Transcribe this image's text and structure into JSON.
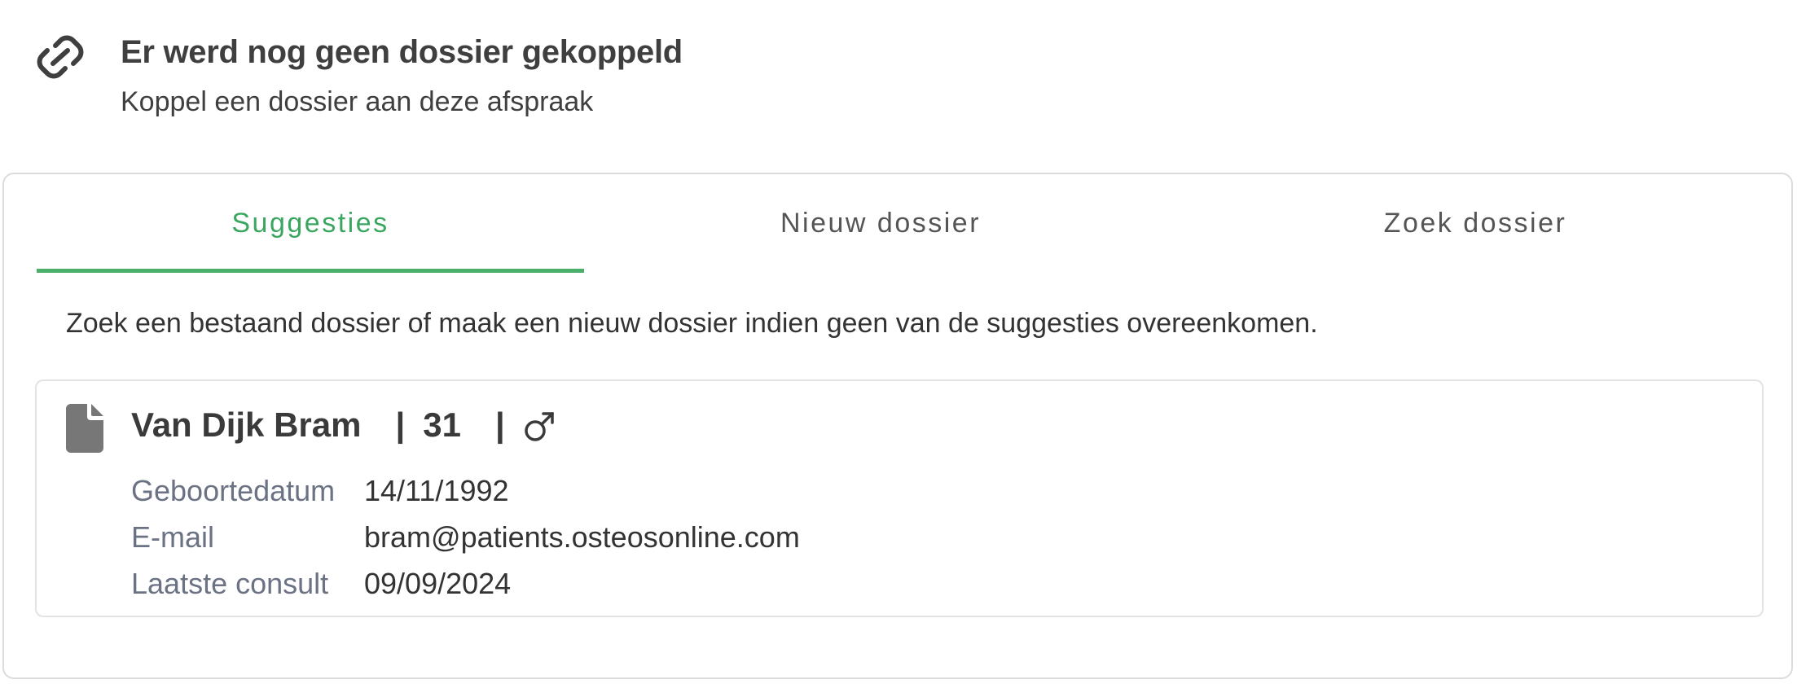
{
  "header": {
    "icon": "link-icon",
    "title": "Er werd nog geen dossier gekoppeld",
    "subtitle": "Koppel een dossier aan deze afspraak"
  },
  "tabs": [
    {
      "label": "Suggesties",
      "active": true
    },
    {
      "label": "Nieuw dossier",
      "active": false
    },
    {
      "label": "Zoek dossier",
      "active": false
    }
  ],
  "helper_text": "Zoek een bestaand dossier of maak een nieuw dossier indien geen van de suggesties overeenkomen.",
  "suggestion": {
    "icon": "file-icon",
    "name": "Van Dijk Bram",
    "separator": "|",
    "age": "31",
    "gender_icon": "male-icon",
    "details": [
      {
        "label": "Geboortedatum",
        "value": "14/11/1992"
      },
      {
        "label": "E-mail",
        "value": "bram@patients.osteosonline.com"
      },
      {
        "label": "Laatste consult",
        "value": "09/09/2024"
      }
    ]
  },
  "colors": {
    "accent": "#4aaf6a",
    "text": "#3c3c3c",
    "label": "#6b7284",
    "border": "#dcdcdc"
  }
}
